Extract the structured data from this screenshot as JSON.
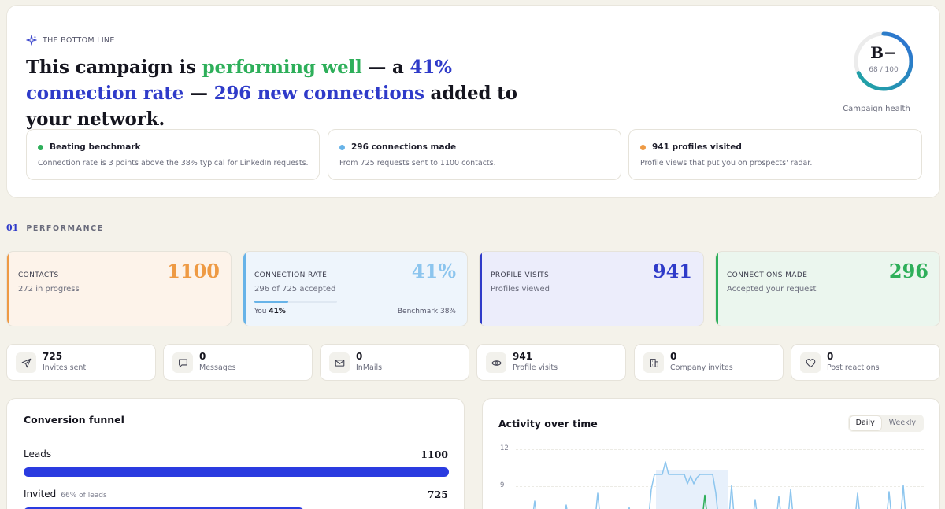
{
  "hero": {
    "eyebrow": "THE BOTTOM LINE",
    "headline_1": "This campaign is ",
    "headline_2": "performing well",
    "headline_3": " — a ",
    "headline_4": "41% connection rate",
    "headline_5": " — ",
    "headline_6": "296 new connections",
    "headline_7": " added to your network.",
    "health": {
      "grade": "B−",
      "score": "68 / 100",
      "score_value": 68,
      "label": "Campaign health"
    },
    "insights": [
      {
        "title": "Beating benchmark",
        "text": "Connection rate is 3 points above the 38% typical for LinkedIn requests.",
        "color": "#2eaf5a"
      },
      {
        "title": "296 connections made",
        "text": "From 725 requests sent to 1100 contacts.",
        "color": "#67b3e8"
      },
      {
        "title": "941 profiles visited",
        "text": "Profile views that put you on prospects' radar.",
        "color": "#ee9a44"
      }
    ]
  },
  "performance": {
    "num": "01",
    "label": "PERFORMANCE",
    "kpis": [
      {
        "label": "CONTACTS",
        "sub": "272 in progress",
        "value": "1100",
        "color": "#ee9a44",
        "bg": "#fdf3ea"
      },
      {
        "label": "CONNECTION RATE",
        "sub": "296 of 725 accepted",
        "value": "41%",
        "color": "#67b3e8",
        "bg": "#eef5fc",
        "progress": 0.41,
        "you_label": "You",
        "you_value": "41%",
        "benchmark": "Benchmark 38%"
      },
      {
        "label": "PROFILE VISITS",
        "sub": "Profiles viewed",
        "value": "941",
        "color": "#2f3bc9",
        "bg": "#ecedfb"
      },
      {
        "label": "CONNECTIONS MADE",
        "sub": "Accepted your request",
        "value": "296",
        "color": "#2eaf5a",
        "bg": "#ebf6ee"
      }
    ],
    "stats": [
      {
        "value": "725",
        "label": "Invites sent",
        "icon": "send-icon"
      },
      {
        "value": "0",
        "label": "Messages",
        "icon": "message-icon"
      },
      {
        "value": "0",
        "label": "InMails",
        "icon": "mail-icon"
      },
      {
        "value": "941",
        "label": "Profile visits",
        "icon": "eye-icon"
      },
      {
        "value": "0",
        "label": "Company invites",
        "icon": "building-icon"
      },
      {
        "value": "0",
        "label": "Post reactions",
        "icon": "heart-icon"
      }
    ]
  },
  "funnel": {
    "title": "Conversion funnel",
    "rows": [
      {
        "label": "Leads",
        "note": "",
        "value": "1100",
        "fraction": 1.0
      },
      {
        "label": "Invited",
        "note": "66% of leads",
        "value": "725",
        "fraction": 0.659
      }
    ]
  },
  "activity": {
    "title": "Activity over time",
    "toggle": [
      "Daily",
      "Weekly"
    ],
    "active_toggle": "Daily",
    "y_ticks": [
      "12",
      "9"
    ]
  }
}
